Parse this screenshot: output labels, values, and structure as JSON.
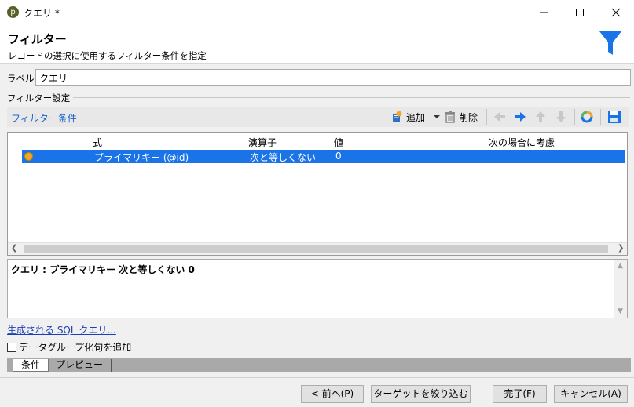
{
  "window": {
    "title": "クエリ *",
    "app_icon_glyph": "p"
  },
  "header": {
    "title": "フィルター",
    "subtitle": "レコードの選択に使用するフィルター条件を指定",
    "icon": "funnel-icon",
    "icon_color": "#1b73e8"
  },
  "label_field": {
    "label": "ラベル:",
    "value": "クエリ"
  },
  "filter_settings": {
    "section_label": "フィルター設定",
    "toolbar": {
      "title": "フィルター条件",
      "add_label": "追加",
      "delete_label": "削除"
    },
    "grid": {
      "columns": [
        "式",
        "演算子",
        "値",
        "次の場合に考慮"
      ],
      "rows": [
        {
          "expression": "プライマリキー (@id)",
          "operator": "次と等しくない",
          "value": "0",
          "consider_if": "",
          "selected": true
        }
      ]
    },
    "description": "クエリ : プライマリキー 次と等しくない 0"
  },
  "sql_link": "生成される SQL クエリ...",
  "add_group_checkbox": {
    "label": "データグループ化句を追加",
    "checked": false
  },
  "tabs": [
    "条件",
    "プレビュー"
  ],
  "footer": {
    "prev": "< 前へ(P)",
    "narrow": "ターゲットを絞り込む >",
    "finish": "完了(F)",
    "cancel": "キャンセル(A)"
  }
}
